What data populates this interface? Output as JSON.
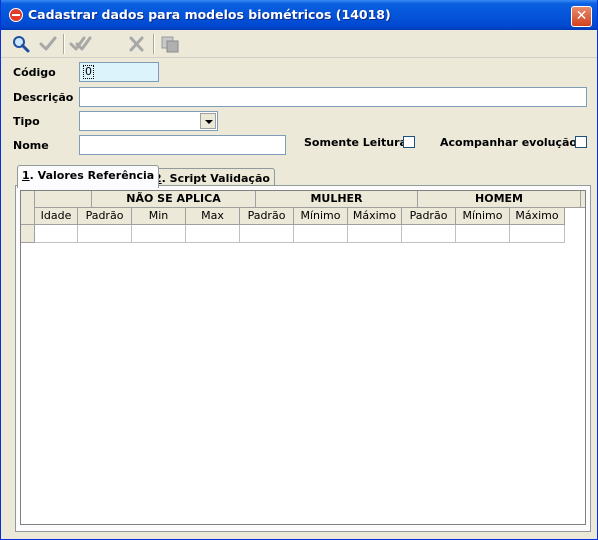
{
  "window": {
    "title": "Cadastrar dados para modelos biométricos (14018)",
    "close_glyph": "✕"
  },
  "toolbar": {
    "buttons": [
      {
        "name": "search",
        "icon": "magnifier-icon"
      },
      {
        "name": "confirm",
        "icon": "check-icon"
      },
      {
        "name": "confirm-all",
        "icon": "double-check-icon"
      },
      {
        "name": "cancel",
        "icon": "x-icon"
      },
      {
        "name": "copy",
        "icon": "copy-icon"
      }
    ]
  },
  "form": {
    "codigo_label": "Código",
    "codigo_value": "0",
    "descricao_label": "Descrição",
    "descricao_value": "",
    "tipo_label": "Tipo",
    "tipo_value": "",
    "nome_label": "Nome",
    "nome_value": "",
    "somente_leitura_label": "Somente Leitura",
    "acompanhar_label": "Acompanhar evolução"
  },
  "tabs": [
    {
      "hotkey": "1",
      "label": ". Valores Referência",
      "active": true
    },
    {
      "hotkey": "2",
      "label": ". Script Validação",
      "active": false
    }
  ],
  "grid": {
    "groups": [
      "NÃO SE APLICA",
      "MULHER",
      "HOMEM"
    ],
    "columns": [
      "Idade",
      "Padrão",
      "Min",
      "Max",
      "Padrão",
      "Mínimo",
      "Máximo",
      "Padrão",
      "Mínimo",
      "Máximo"
    ],
    "rows": [
      [
        "",
        "",
        "",
        "",
        "",
        "",
        "",
        "",
        "",
        ""
      ]
    ]
  },
  "colors": {
    "titlebar": "#0555da",
    "code_field_bg": "#ddf3fb",
    "face": "#ece9d8"
  }
}
